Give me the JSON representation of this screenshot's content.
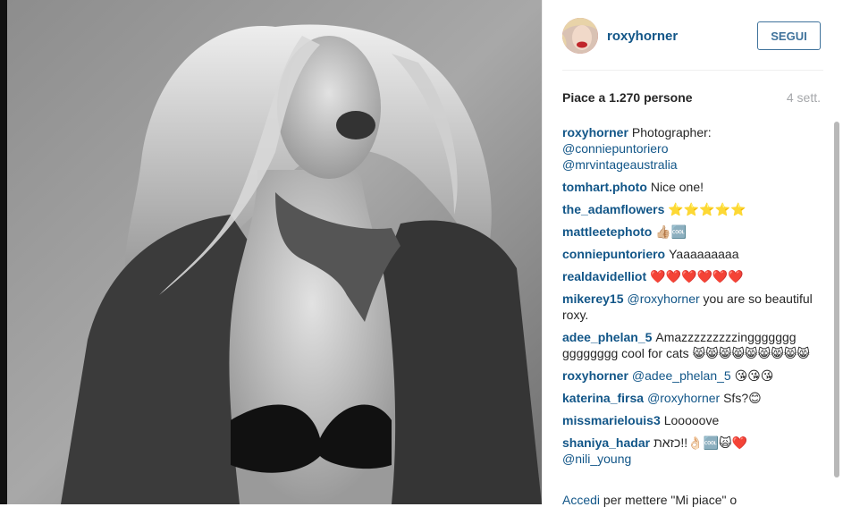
{
  "post": {
    "username": "roxyhorner",
    "follow_label": "SEGUI",
    "likes": "Piace a 1.270 persone",
    "time": "4 sett."
  },
  "comments": [
    {
      "user": "roxyhorner",
      "text": "Photographer:",
      "mentions": [
        "@conniepuntoriero",
        "@mrvintageaustralia"
      ]
    },
    {
      "user": "tomhart.photo",
      "text": "Nice one!"
    },
    {
      "user": "the_adamflowers",
      "text": "⭐⭐⭐⭐⭐"
    },
    {
      "user": "mattleetephoto",
      "text": "👍🏼🆒"
    },
    {
      "user": "conniepuntoriero",
      "text": "Yaaaaaaaaa"
    },
    {
      "user": "realdavidelliot",
      "text": "❤️❤️❤️❤️❤️❤️"
    },
    {
      "user": "mikerey15",
      "mention": "@roxyhorner",
      "text": "you are so beautiful roxy."
    },
    {
      "user": "adee_phelan_5",
      "text": "Amazzzzzzzzzinggggggg gggggggg cool for cats 😸😸😸😸😸😸😸😸😸"
    },
    {
      "user": "roxyhorner",
      "mention": "@adee_phelan_5",
      "text": "😘😘😘"
    },
    {
      "user": "katerina_firsa",
      "mention": "@roxyhorner",
      "text": "Sfs?😊"
    },
    {
      "user": "missmarielouis3",
      "text": "Looooove"
    },
    {
      "user": "shaniya_hadar",
      "text": "כזאת!!👌🏻🆒🙀❤️",
      "mention_after": "@nili_young"
    }
  ],
  "footer": {
    "login_link": "Accedi",
    "login_rest": "per mettere \"Mi piace\" o"
  },
  "colors": {
    "link": "#125688",
    "follow": "#3f729b",
    "muted": "#a5a7aa"
  },
  "icons": [
    "avatar-photo",
    "post-photo"
  ]
}
